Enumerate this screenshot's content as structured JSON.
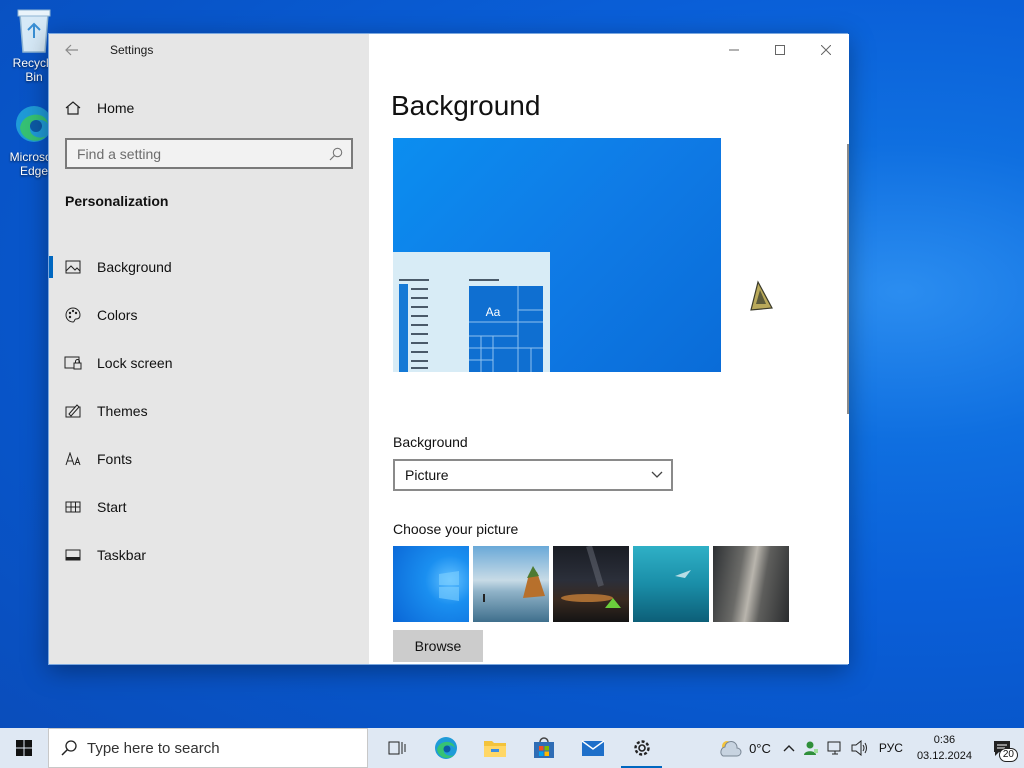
{
  "desktop": {
    "icons": [
      {
        "label": "Recycle Bin",
        "icon": "recycle-bin-icon"
      },
      {
        "label": "Microsoft Edge",
        "icon": "edge-icon"
      }
    ]
  },
  "window": {
    "app_title": "Settings",
    "controls": {
      "minimize": "minimize-icon",
      "maximize": "maximize-icon",
      "close": "close-icon"
    }
  },
  "sidebar": {
    "home_label": "Home",
    "search_placeholder": "Find a setting",
    "section_title": "Personalization",
    "items": [
      {
        "label": "Background",
        "icon": "picture-icon",
        "active": true
      },
      {
        "label": "Colors",
        "icon": "palette-icon",
        "active": false
      },
      {
        "label": "Lock screen",
        "icon": "lock-screen-icon",
        "active": false
      },
      {
        "label": "Themes",
        "icon": "themes-icon",
        "active": false
      },
      {
        "label": "Fonts",
        "icon": "fonts-icon",
        "active": false
      },
      {
        "label": "Start",
        "icon": "start-icon",
        "active": false
      },
      {
        "label": "Taskbar",
        "icon": "taskbar-icon",
        "active": false
      }
    ]
  },
  "main": {
    "page_title": "Background",
    "preview_tile_text": "Aa",
    "background_label": "Background",
    "background_value": "Picture",
    "choose_label": "Choose your picture",
    "browse_label": "Browse"
  },
  "taskbar": {
    "search_placeholder": "Type here to search",
    "apps": [
      "task-view-icon",
      "edge-icon",
      "file-explorer-icon",
      "store-icon",
      "mail-icon",
      "settings-icon"
    ],
    "weather": "0°C",
    "language": "РУС",
    "time": "0:36",
    "date": "03.12.2024",
    "notification_count": "20"
  },
  "colors": {
    "accent": "#0067c0",
    "sidebar_bg": "#e6e6e6",
    "desktop_bg": "#0a5fd8"
  }
}
